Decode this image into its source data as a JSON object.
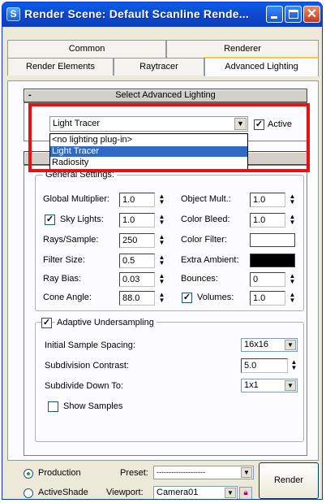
{
  "window": {
    "title": "Render Scene: Default Scanline Rende...",
    "title_icon": "S"
  },
  "tabs": {
    "row1": [
      "Common",
      "Renderer"
    ],
    "row2": [
      "Render Elements",
      "Raytracer",
      "Advanced Lighting"
    ],
    "active": "Advanced Lighting"
  },
  "select_rollout": {
    "title": "Select Advanced Lighting",
    "collapse_glyph": "-",
    "plugin_value": "Light Tracer",
    "active_label": "Active",
    "active_checked": true,
    "dropdown_options": [
      "<no lighting plug-in>",
      "Light Tracer",
      "Radiosity"
    ],
    "highlighted_option": "Light Tracer"
  },
  "params_rollout": {
    "collapse_glyph": "-",
    "general_settings_label": "General Settings:",
    "left": {
      "global_multiplier_label": "Global Multiplier:",
      "global_multiplier": "1.0",
      "sky_lights_label": "Sky Lights:",
      "sky_lights_checked": true,
      "sky_lights": "1.0",
      "rays_sample_label": "Rays/Sample:",
      "rays_sample": "250",
      "filter_size_label": "Filter Size:",
      "filter_size": "0.5",
      "ray_bias_label": "Ray Bias:",
      "ray_bias": "0.03",
      "cone_angle_label": "Cone Angle:",
      "cone_angle": "88.0"
    },
    "right": {
      "object_mult_label": "Object Mult.:",
      "object_mult": "1.0",
      "color_bleed_label": "Color Bleed:",
      "color_bleed": "1.0",
      "color_filter_label": "Color Filter:",
      "color_filter_color": "#ffffff",
      "extra_ambient_label": "Extra Ambient:",
      "extra_ambient_color": "#000000",
      "bounces_label": "Bounces:",
      "bounces": "0",
      "volumes_label": "Volumes:",
      "volumes_checked": true,
      "volumes": "1.0"
    },
    "adaptive": {
      "label": "Adaptive Undersampling",
      "checked": true,
      "initial_spacing_label": "Initial Sample Spacing:",
      "initial_spacing": "16x16",
      "subdiv_contrast_label": "Subdivision Contrast:",
      "subdiv_contrast": "5.0",
      "subdivide_down_label": "Subdivide Down To:",
      "subdivide_down": "1x1",
      "show_samples_label": "Show Samples",
      "show_samples_checked": false
    }
  },
  "footer": {
    "production_label": "Production",
    "activeshade_label": "ActiveShade",
    "production_selected": true,
    "preset_label": "Preset:",
    "preset_value": "--------------------",
    "viewport_label": "Viewport:",
    "viewport_value": "Camera01",
    "render_label": "Render"
  },
  "colors": {
    "highlight_border": "#e81010",
    "selection": "#316ac5",
    "titlebar": "#0f49d0"
  },
  "icons": [
    "close-icon",
    "minimize-icon",
    "maximize-icon",
    "lock-icon",
    "chevron-down-icon"
  ]
}
